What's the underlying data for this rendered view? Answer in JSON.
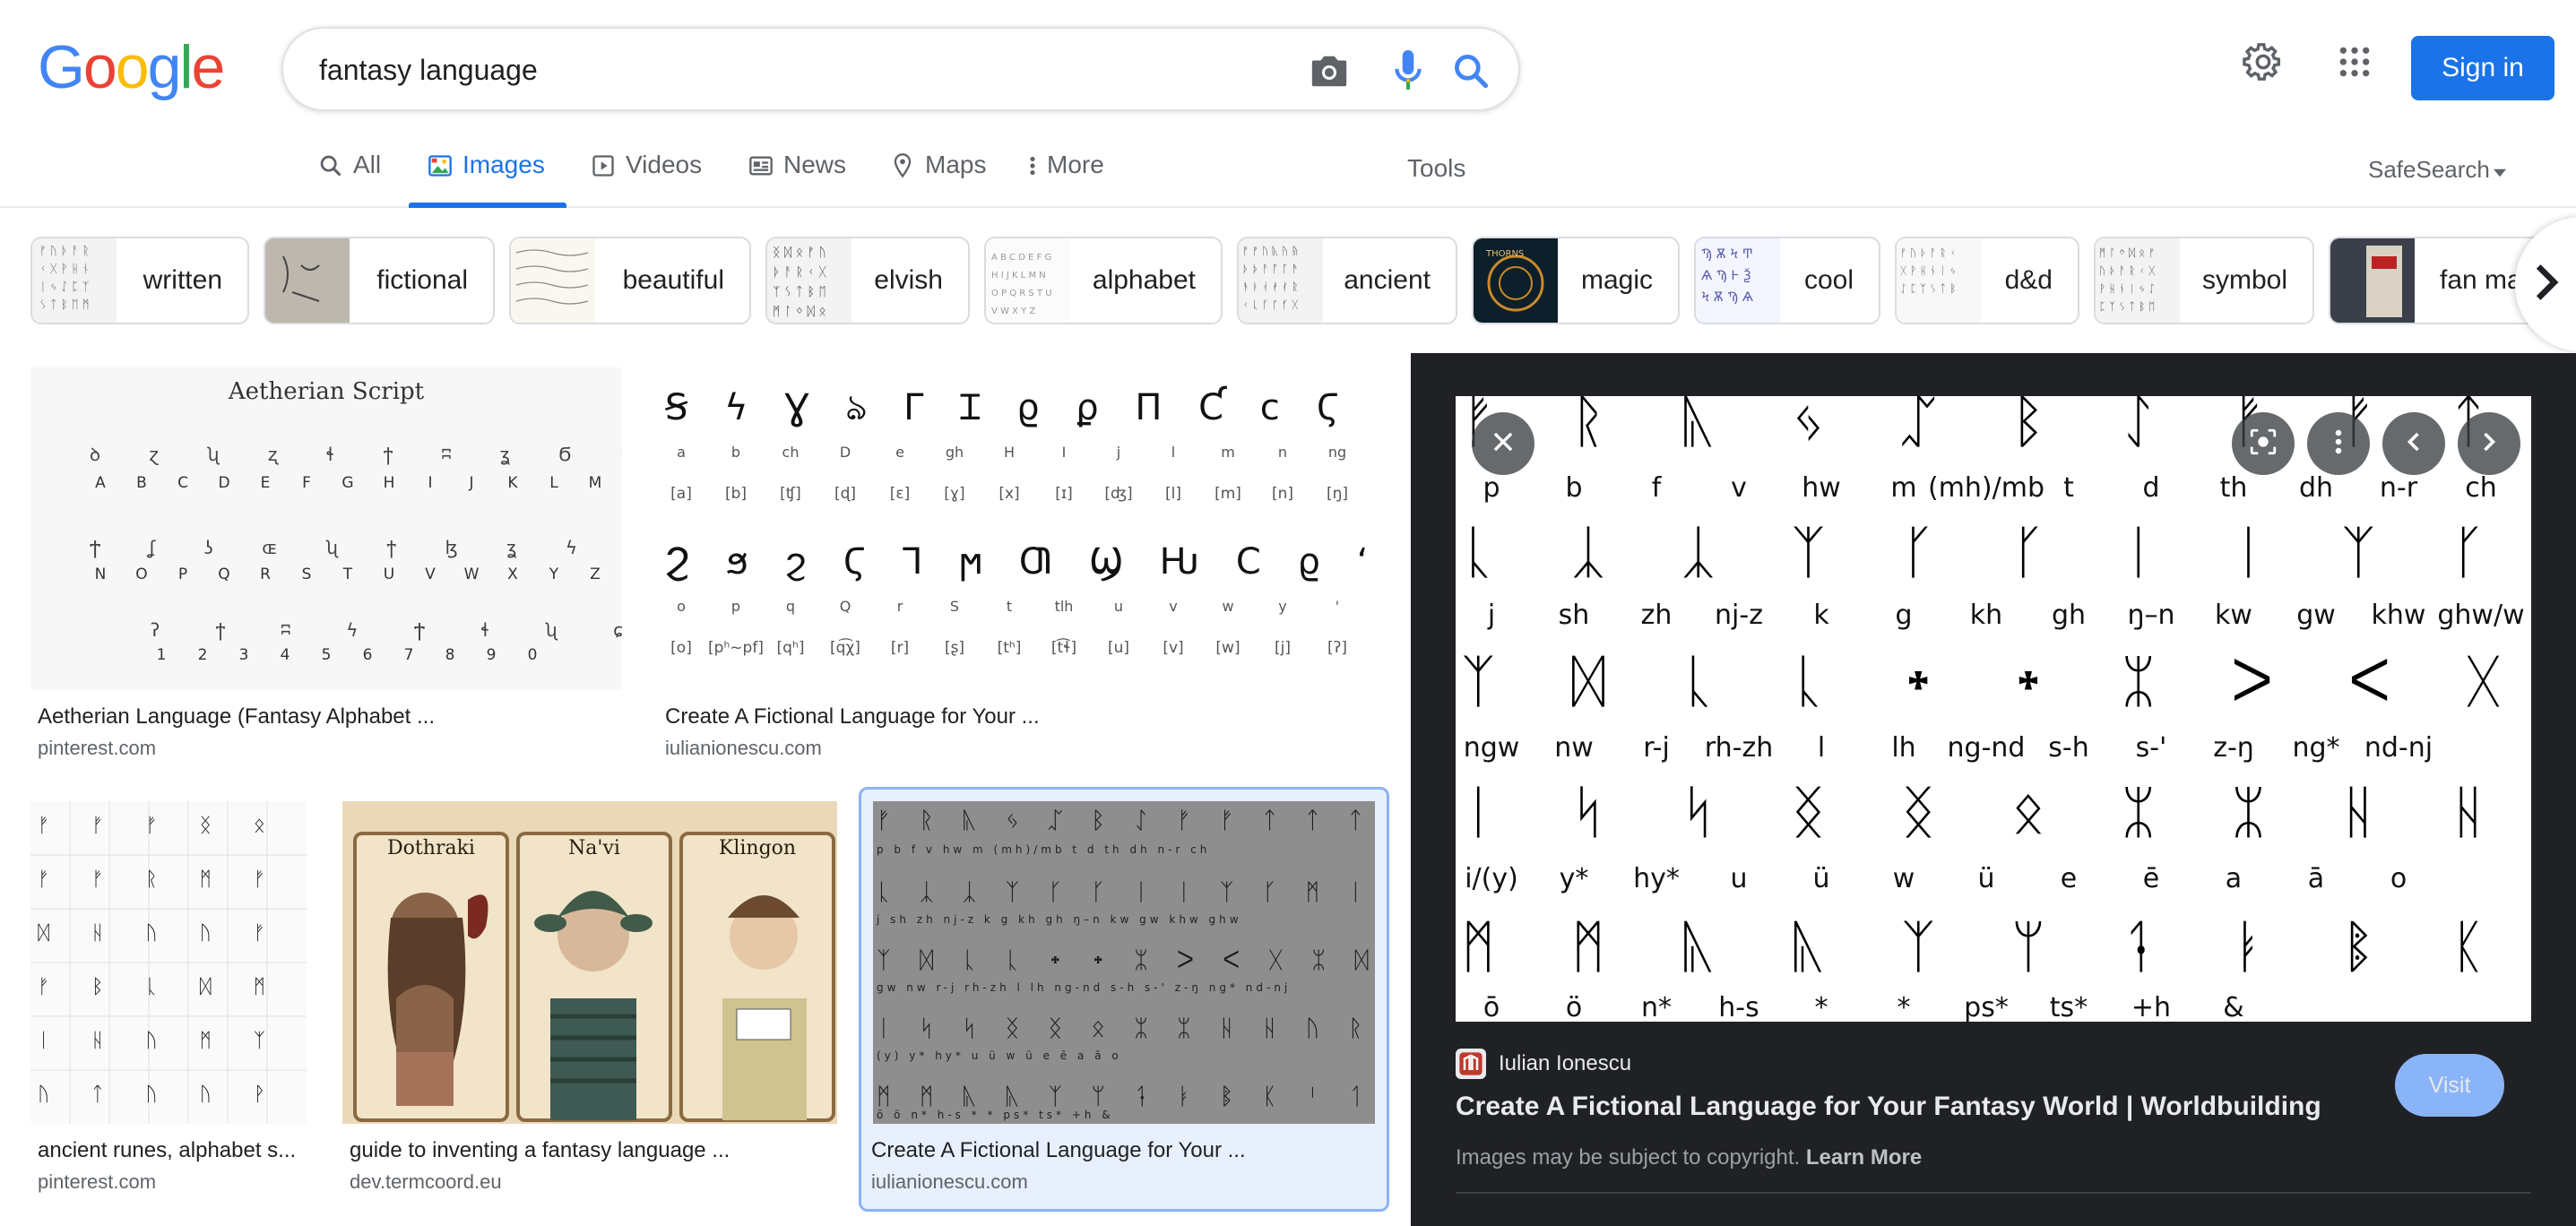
{
  "logo": [
    "G",
    "o",
    "o",
    "g",
    "l",
    "e"
  ],
  "search": {
    "query": "fantasy language"
  },
  "header": {
    "sign_in": "Sign in"
  },
  "tabs": [
    {
      "label": "All",
      "icon": "search-icon"
    },
    {
      "label": "Images",
      "icon": "images-icon"
    },
    {
      "label": "Videos",
      "icon": "video-icon"
    },
    {
      "label": "News",
      "icon": "news-icon"
    },
    {
      "label": "Maps",
      "icon": "map-pin-icon"
    },
    {
      "label": "More",
      "icon": "more-vert-icon"
    }
  ],
  "tools_label": "Tools",
  "safesearch_label": "SafeSearch",
  "chips": [
    "written",
    "fictional",
    "beautiful",
    "elvish",
    "alphabet",
    "ancient",
    "magic",
    "cool",
    "d&d",
    "symbol",
    "fan ma"
  ],
  "results": [
    {
      "title": "Aetherian Language (Fantasy Alphabet ...",
      "source": "pinterest.com",
      "image_heading": "Aetherian Script"
    },
    {
      "title": "Create A Fictional Language for Your ...",
      "source": "iulianionescu.com"
    },
    {
      "title": "ancient runes, alphabet s...",
      "source": "pinterest.com"
    },
    {
      "title": "guide to inventing a fantasy language ...",
      "source": "dev.termcoord.eu",
      "image_labels": [
        "Dothraki",
        "Na'vi",
        "Klingon"
      ]
    },
    {
      "title": "Create A Fictional Language for Your ...",
      "source": "iulianionescu.com"
    }
  ],
  "aetherian": {
    "row1": [
      "A",
      "B",
      "C",
      "D",
      "E",
      "F",
      "G",
      "H",
      "I",
      "J",
      "K",
      "L",
      "M"
    ],
    "row2": [
      "N",
      "O",
      "P",
      "Q",
      "R",
      "S",
      "T",
      "U",
      "V",
      "W",
      "X",
      "Y",
      "Z"
    ],
    "row3": [
      "1",
      "2",
      "3",
      "4",
      "5",
      "6",
      "7",
      "8",
      "9",
      "0"
    ]
  },
  "fictional_chart": {
    "row1_latin": [
      "a",
      "b",
      "ch",
      "D",
      "e",
      "gh",
      "H",
      "I",
      "j",
      "l",
      "m",
      "n",
      "ng"
    ],
    "row1_ipa": [
      "[a]",
      "[b]",
      "[ʧ]",
      "[ɖ]",
      "[ɛ]",
      "[ɣ]",
      "[x]",
      "[ɪ]",
      "[ʤ]",
      "[l]",
      "[m]",
      "[n]",
      "[ŋ]"
    ],
    "row2_latin": [
      "o",
      "p",
      "q",
      "Q",
      "r",
      "S",
      "t",
      "tlh",
      "u",
      "v",
      "w",
      "y",
      "'"
    ],
    "row2_ipa": [
      "[o]",
      "[pʰ~pf]",
      "[qʰ]",
      "[q͡χ]",
      "[r]",
      "[ʂ]",
      "[tʰ]",
      "[t͡ɬ]",
      "[u]",
      "[v]",
      "[w]",
      "[j]",
      "[ʔ]"
    ]
  },
  "panel": {
    "source_name": "Iulian Ionescu",
    "title": "Create A Fictional Language for Your Fantasy World | Worldbuilding",
    "visit": "Visit",
    "copyright": "Images may be subject to copyright.",
    "learn_more": "Learn More",
    "rows": [
      [
        "p",
        "b",
        "f",
        "v",
        "hw",
        "m",
        "(mh)/mb",
        "t",
        "d",
        "th",
        "dh",
        "n-r",
        "ch"
      ],
      [
        "j",
        "sh",
        "zh",
        "nj-z",
        "k",
        "g",
        "kh",
        "gh",
        "ŋ–n",
        "kw",
        "gw",
        "khw",
        "ghw/w"
      ],
      [
        "ngw",
        "nw",
        "r-j",
        "rh-zh",
        "l",
        "lh",
        "ng-nd",
        "s-h",
        "s-'",
        "z-ŋ",
        "ng*",
        "nd-nj"
      ],
      [
        "i/(y)",
        "y*",
        "hy*",
        "u",
        "ü",
        "w",
        "ü",
        "e",
        "ē",
        "a",
        "ā",
        "o"
      ],
      [
        "ō",
        "ö",
        "n*",
        "h-s",
        "*",
        "*",
        "ps*",
        "ts*",
        "+h",
        "&"
      ]
    ]
  }
}
